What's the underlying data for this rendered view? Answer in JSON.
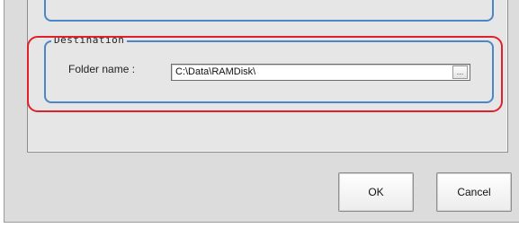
{
  "destination": {
    "group_title": "Destination",
    "folder_label": "Folder name :",
    "folder_value": "C:\\Data\\RAMDisk\\",
    "browse_label": "..."
  },
  "buttons": {
    "ok_label": "OK",
    "cancel_label": "Cancel"
  },
  "colors": {
    "group_border": "#4a86c8",
    "highlight": "#e0202a",
    "dialog_bg": "#dcdcdc"
  }
}
